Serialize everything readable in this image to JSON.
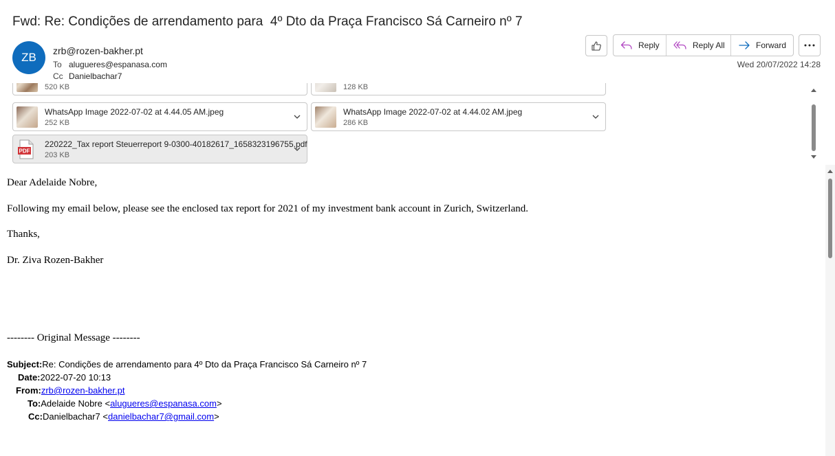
{
  "email": {
    "subject": "Fwd: Re: Condições de arrendamento para  4º Dto da Praça Francisco Sá Carneiro nº 7",
    "avatar_initials": "ZB",
    "sender": "zrb@rozen-bakher.pt",
    "to_label": "To",
    "to_value": "alugueres@espanasa.com",
    "cc_label": "Cc",
    "cc_value": "Danielbachar7",
    "date": "Wed 20/07/2022 14:28"
  },
  "actions": {
    "like_icon": "thumbs-up-icon",
    "reply": "Reply",
    "reply_all": "Reply All",
    "forward": "Forward",
    "more_icon": "more-icon"
  },
  "attachments": [
    {
      "name": "",
      "size": "520 KB",
      "type": "image"
    },
    {
      "name": "",
      "size": "128 KB",
      "type": "image"
    },
    {
      "name": "WhatsApp Image 2022-07-02 at 4.44.05 AM.jpeg",
      "size": "252 KB",
      "type": "image"
    },
    {
      "name": "WhatsApp Image 2022-07-02 at 4.44.02 AM.jpeg",
      "size": "286 KB",
      "type": "image"
    },
    {
      "name": "220222_Tax report Steuerreport 9-0300-40182617_1658323196755.pdf",
      "size": "203 KB",
      "type": "pdf",
      "badge": "PDF"
    }
  ],
  "body": {
    "greeting": "Dear Adelaide Nobre,",
    "paragraph": "Following my email below, please see the enclosed tax report for 2021 of my investment bank account in Zurich, Switzerland.",
    "thanks": "Thanks,",
    "signature": "Dr. Ziva Rozen-Bakher",
    "separator": "-------- Original Message --------"
  },
  "original": {
    "subject_label": "Subject:",
    "subject_value": "Re: Condições de arrendamento para 4º Dto da Praça Francisco Sá Carneiro nº 7",
    "date_label": "Date:",
    "date_value": "2022-07-20 10:13",
    "from_label": "From:",
    "from_link": "zrb@rozen-bakher.pt",
    "to_label": "To:",
    "to_name": "Adelaide Nobre <",
    "to_link": "alugueres@espanasa.com",
    "to_close": ">",
    "cc_label": "Cc:",
    "cc_name": "Danielbachar7 <",
    "cc_link": "danielbachar7@gmail.com",
    "cc_close": ">"
  }
}
